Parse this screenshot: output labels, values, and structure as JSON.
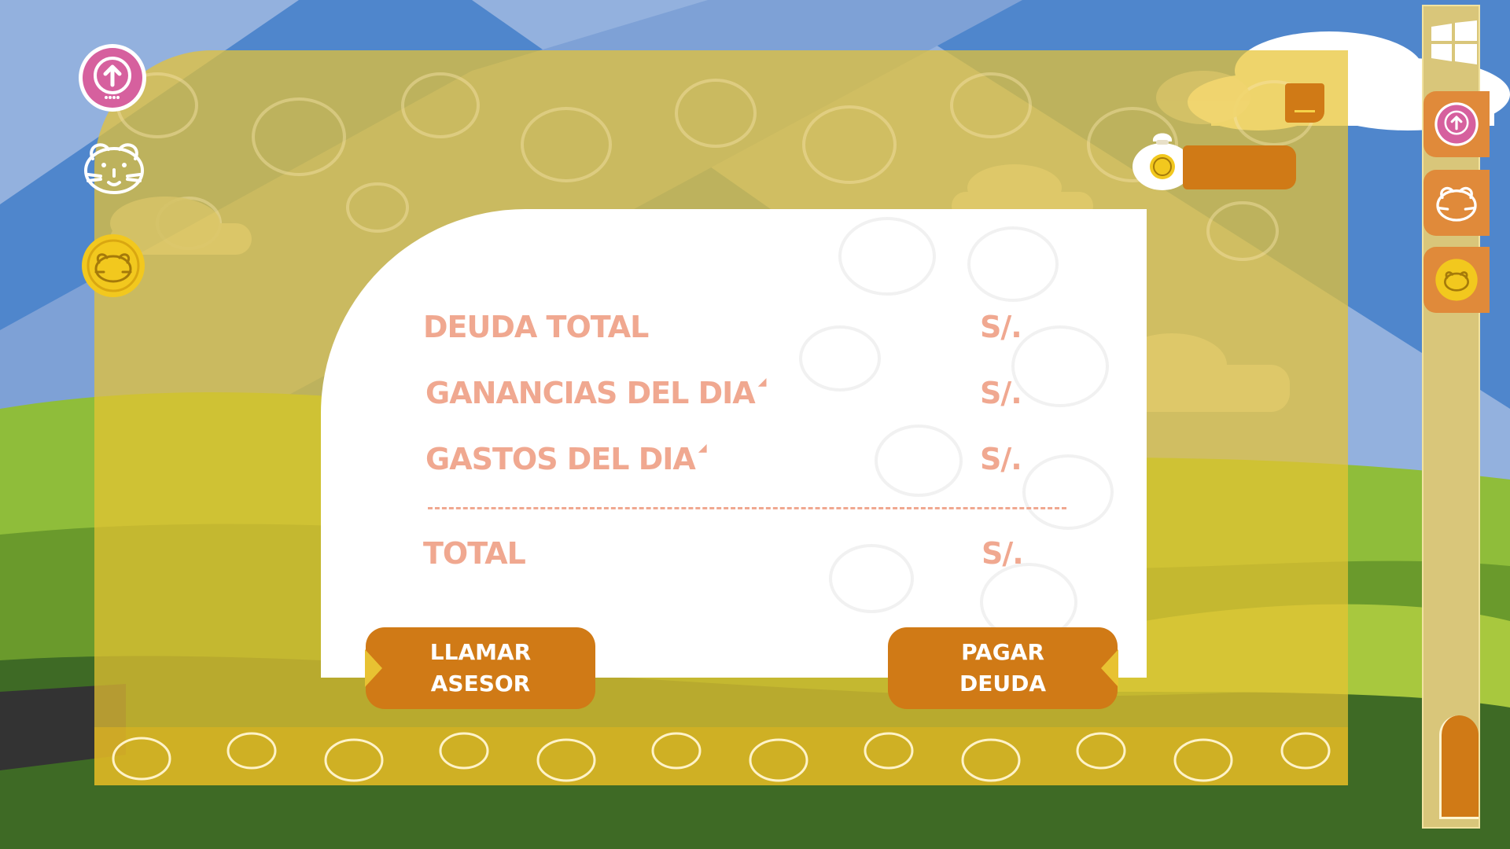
{
  "summary": {
    "rows": [
      {
        "label": "DEUDA TOTAL",
        "currency": "S/.",
        "has_marker": false
      },
      {
        "label": "GANANCIAS DEL DIA",
        "currency": "S/.",
        "has_marker": true
      },
      {
        "label": "GASTOS DEL DIA",
        "currency": "S/.",
        "has_marker": true
      }
    ],
    "total": {
      "label": "TOTAL",
      "currency": "S/."
    }
  },
  "buttons": {
    "call_advisor": {
      "line1": "LLAMAR",
      "line2": "ASESOR"
    },
    "pay_debt": {
      "line1": "PAGAR",
      "line2": "DEUDA"
    }
  },
  "icons": {
    "left": [
      "upload-icon",
      "guinea-pig-icon",
      "guinea-pig-coin-icon"
    ],
    "right_tabs": [
      "upload-icon",
      "guinea-pig-icon",
      "guinea-pig-coin-icon"
    ],
    "top_right": [
      "coin-bag-icon",
      "menu-icon",
      "windows-logo-icon"
    ]
  },
  "colors": {
    "accent_orange": "#d07a16",
    "label_salmon": "#f0a890",
    "panel_yellow": "#e8c332",
    "upload_pink": "#d6609e"
  }
}
